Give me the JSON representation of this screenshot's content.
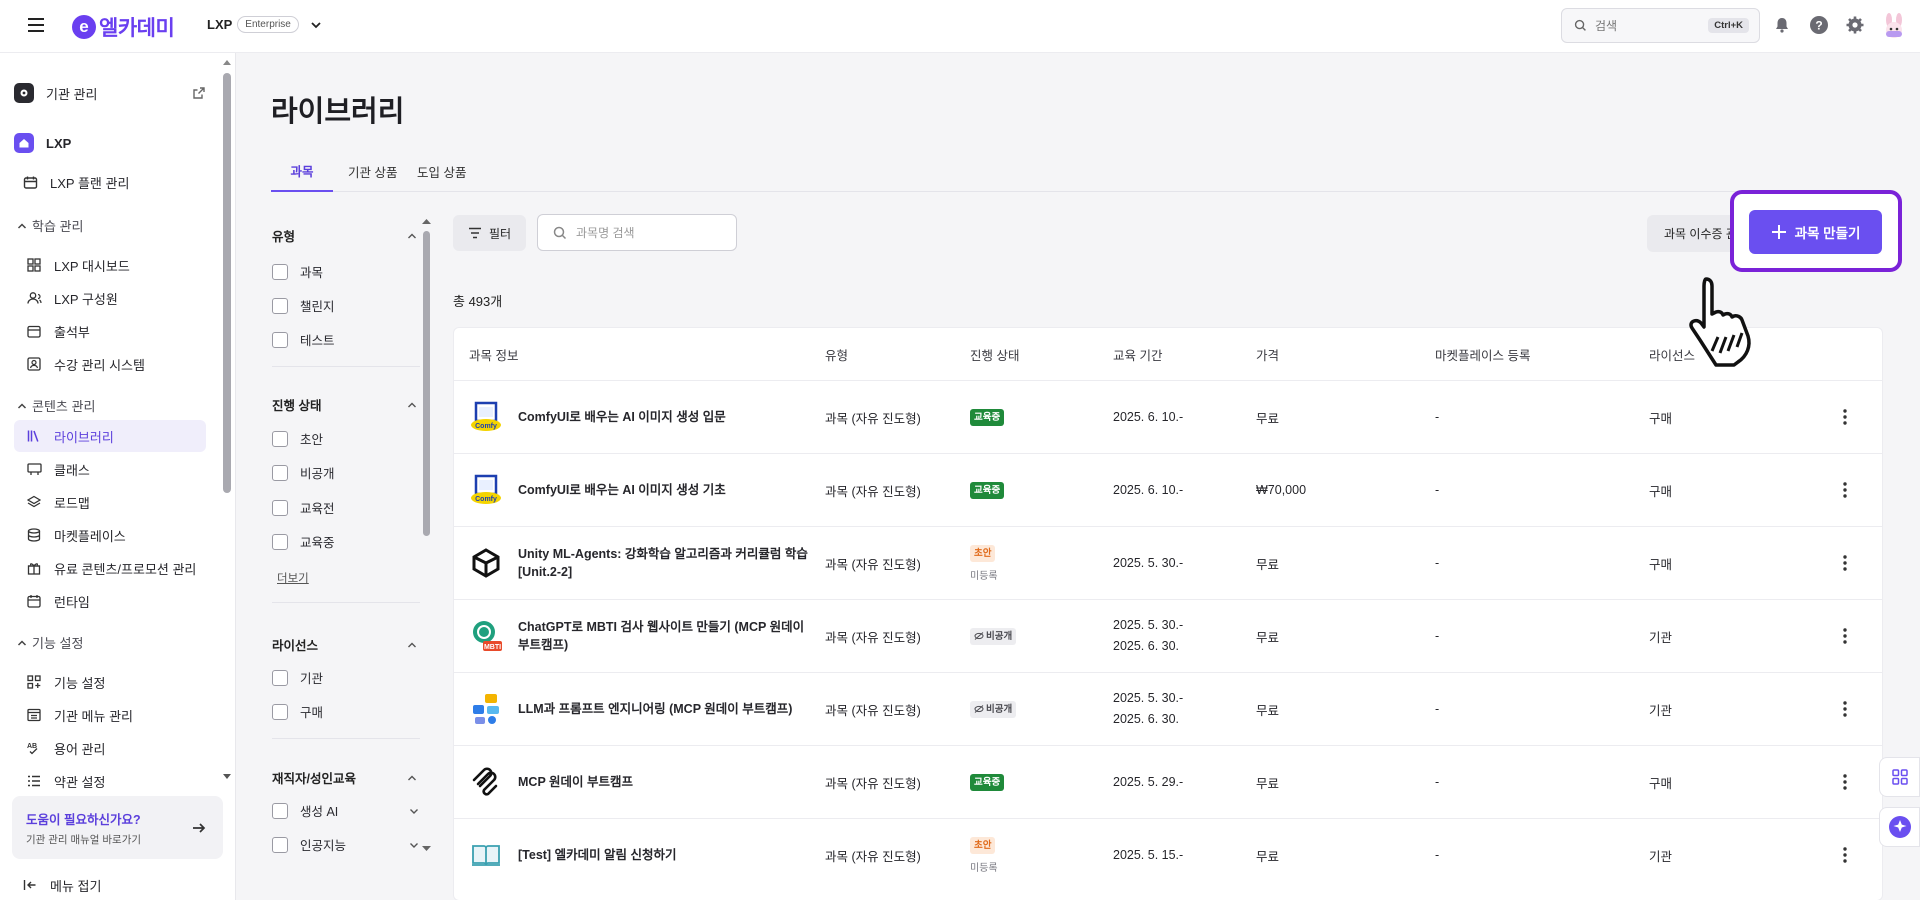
{
  "topbar": {
    "logo_text": "엘카데미",
    "product": "LXP",
    "plan_badge": "Enterprise",
    "search_placeholder": "검색",
    "search_shortcut": "Ctrl+K"
  },
  "sidebar": {
    "org_admin": "기관 관리",
    "lxp": "LXP",
    "lxp_plan": "LXP 플랜 관리",
    "sections": {
      "learning": "학습 관리",
      "content": "콘텐츠 관리",
      "feature": "기능 설정"
    },
    "learning_items": [
      "LXP 대시보드",
      "LXP 구성원",
      "출석부",
      "수강 관리 시스템"
    ],
    "content_items": [
      "라이브러리",
      "클래스",
      "로드맵",
      "마켓플레이스",
      "유료 콘텐츠/프로모션 관리",
      "런타임"
    ],
    "feature_items": [
      "기능 설정",
      "기관 메뉴 관리",
      "용어 관리",
      "약관 설정"
    ],
    "help_title": "도움이 필요하신가요?",
    "help_sub": "기관 관리 매뉴얼 바로가기",
    "collapse": "메뉴 접기"
  },
  "page": {
    "title": "라이브러리",
    "tabs": [
      "과목",
      "기관 상품",
      "도입 상품"
    ],
    "filter_button": "필터",
    "search_placeholder": "과목명 검색",
    "completion_button": "과목 이수증 관",
    "create_button": "과목 만들기",
    "total": "총 493개"
  },
  "filters": {
    "type_title": "유형",
    "type_options": [
      "과목",
      "챌린지",
      "테스트"
    ],
    "status_title": "진행 상태",
    "status_options": [
      "초안",
      "비공개",
      "교육전",
      "교육중"
    ],
    "more": "더보기",
    "license_title": "라이선스",
    "license_options": [
      "기관",
      "구매"
    ],
    "adult_title": "재직자/성인교육",
    "adult_options": [
      "생성 AI",
      "인공지능"
    ]
  },
  "table": {
    "headers": [
      "과목 정보",
      "유형",
      "진행 상태",
      "교육 기간",
      "가격",
      "마켓플레이스 등록",
      "라이선스"
    ],
    "rows": [
      {
        "name": "ComfyUI로 배우는 AI 이미지 생성 입문",
        "type": "과목 (자유 진도형)",
        "status": "교육중",
        "status_kind": "green",
        "status_sub": "",
        "period1": "2025. 6. 10.-",
        "period2": "",
        "price": "무료",
        "market": "-",
        "license": "구매",
        "thumb": "comfy-thumb"
      },
      {
        "name": "ComfyUI로 배우는 AI 이미지 생성 기초",
        "type": "과목 (자유 진도형)",
        "status": "교육중",
        "status_kind": "green",
        "status_sub": "",
        "period1": "2025. 6. 10.-",
        "period2": "",
        "price": "₩70,000",
        "market": "-",
        "license": "구매",
        "thumb": "comfy-thumb"
      },
      {
        "name": "Unity ML-Agents: 강화학습 알고리즘과 커리큘럼 학습[Unit.2-2]",
        "type": "과목 (자유 진도형)",
        "status": "초안",
        "status_kind": "orange",
        "status_sub": "미등록",
        "period1": "2025. 5. 30.-",
        "period2": "",
        "price": "무료",
        "market": "-",
        "license": "구매",
        "thumb": "unity-thumb"
      },
      {
        "name": "ChatGPT로 MBTI 검사 웹사이트 만들기 (MCP 원데이 부트캠프)",
        "type": "과목 (자유 진도형)",
        "status": "비공개",
        "status_kind": "gray",
        "status_sub": "",
        "period1": "2025. 5. 30.-",
        "period2": "2025. 6. 30.",
        "price": "무료",
        "market": "-",
        "license": "기관",
        "thumb": "gpt-thumb"
      },
      {
        "name": "LLM과 프롬프트 엔지니어링 (MCP 원데이 부트캠프)",
        "type": "과목 (자유 진도형)",
        "status": "비공개",
        "status_kind": "gray",
        "status_sub": "",
        "period1": "2025. 5. 30.-",
        "period2": "2025. 6. 30.",
        "price": "무료",
        "market": "-",
        "license": "기관",
        "thumb": "llm-thumb"
      },
      {
        "name": "MCP 원데이 부트캠프",
        "type": "과목 (자유 진도형)",
        "status": "교육중",
        "status_kind": "green",
        "status_sub": "",
        "period1": "2025. 5. 29.-",
        "period2": "",
        "price": "무료",
        "market": "-",
        "license": "구매",
        "thumb": "mcp-thumb"
      },
      {
        "name": "[Test] 엘카데미 알림 신청하기",
        "type": "과목 (자유 진도형)",
        "status": "초안",
        "status_kind": "orange",
        "status_sub": "미등록",
        "period1": "2025. 5. 15.-",
        "period2": "",
        "price": "무료",
        "market": "-",
        "license": "기관",
        "thumb": "book-thumb"
      }
    ]
  },
  "colors": {
    "accent": "#6a4ff0",
    "green": "#1f8a3a",
    "orange": "#e06a1a",
    "highlight": "#7a22d8"
  }
}
